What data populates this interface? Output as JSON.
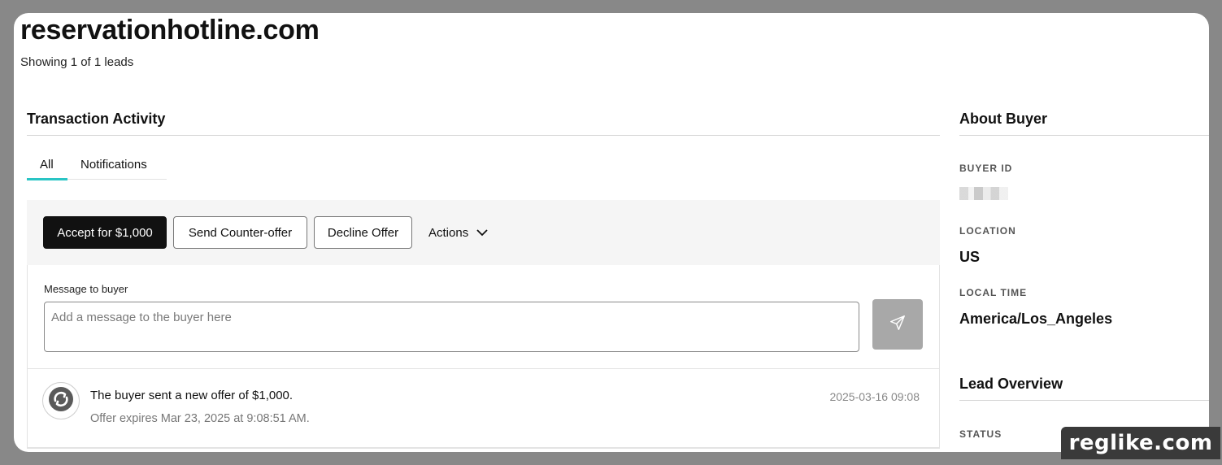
{
  "page": {
    "site_title": "reservationhotline.com",
    "lead_count": "Showing 1 of 1 leads"
  },
  "transaction": {
    "heading": "Transaction Activity",
    "tabs": [
      {
        "label": "All",
        "active": true
      },
      {
        "label": "Notifications",
        "active": false
      }
    ],
    "actions": {
      "accept_label": "Accept for $1,000",
      "counter_label": "Send Counter-offer",
      "decline_label": "Decline Offer",
      "more_label": "Actions"
    },
    "message": {
      "label": "Message to buyer",
      "placeholder": "Add a message to the buyer here",
      "value": ""
    },
    "activity": [
      {
        "text": "The buyer sent a new offer of $1,000.",
        "subtext": "Offer expires Mar 23, 2025 at 9:08:51 AM.",
        "timestamp": "2025-03-16 09:08"
      }
    ]
  },
  "about_buyer": {
    "heading": "About Buyer",
    "buyer_id_label": "BUYER ID",
    "location_label": "LOCATION",
    "location_value": "US",
    "local_time_label": "LOCAL TIME",
    "local_time_value": "America/Los_Angeles"
  },
  "lead_overview": {
    "heading": "Lead Overview",
    "status_label": "STATUS"
  },
  "watermark": "reglike.com",
  "colors": {
    "tab_accent": "#29c4c4",
    "primary_button": "#111111",
    "send_button": "#a8a8a8",
    "backdrop": "#888888"
  }
}
